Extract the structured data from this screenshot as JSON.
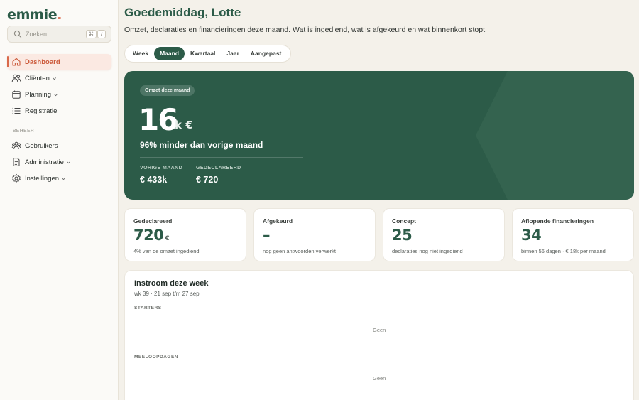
{
  "app": {
    "logo": "emmie"
  },
  "search": {
    "placeholder": "Zoeken...",
    "kbd_1": "⌘",
    "kbd_2": "/"
  },
  "sidebar": {
    "items": [
      {
        "label": "Dashboard"
      },
      {
        "label": "Cliënten"
      },
      {
        "label": "Planning"
      },
      {
        "label": "Registratie"
      }
    ],
    "section": "BEHEER",
    "admin_items": [
      {
        "label": "Gebruikers"
      },
      {
        "label": "Administratie"
      },
      {
        "label": "Instellingen"
      }
    ]
  },
  "header": {
    "greeting": "Goedemiddag, Lotte",
    "subtitle": "Omzet, declaraties en financieringen deze maand. Wat is ingediend, wat is afgekeurd en wat binnenkort stopt."
  },
  "periods": {
    "options": [
      "Week",
      "Maand",
      "Kwartaal",
      "Jaar",
      "Aangepast"
    ],
    "selected": "Maand"
  },
  "hero": {
    "pill": "Omzet deze maand",
    "value": "16",
    "unit": "k €",
    "change": "96% minder dan vorige maand",
    "metrics": [
      {
        "label": "VORIGE MAAND",
        "value": "€ 433k"
      },
      {
        "label": "GEDECLAREERD",
        "value": "€ 720"
      }
    ]
  },
  "cards": [
    {
      "title": "Gedeclareerd",
      "value": "720",
      "unit": "€",
      "sub": "4% van de omzet ingediend"
    },
    {
      "title": "Afgekeurd",
      "value": "–",
      "unit": "",
      "sub": "nog geen antwoorden verwerkt"
    },
    {
      "title": "Concept",
      "value": "25",
      "unit": "",
      "sub": "declaraties nog niet ingediend"
    },
    {
      "title": "Aflopende financieringen",
      "value": "34",
      "unit": "",
      "sub": "binnen 56 dagen · € 18k per maand"
    }
  ],
  "inflow": {
    "title": "Instroom deze week",
    "subtitle": "wk 39 · 21 sep t/m 27 sep",
    "groups": [
      {
        "label": "STARTERS",
        "empty": "Geen"
      },
      {
        "label": "MEELOOPDAGEN",
        "empty": "Geen"
      }
    ]
  },
  "colors": {
    "brand": "#2c5b48",
    "accent": "#d9694a",
    "background": "#f4f1ea"
  }
}
